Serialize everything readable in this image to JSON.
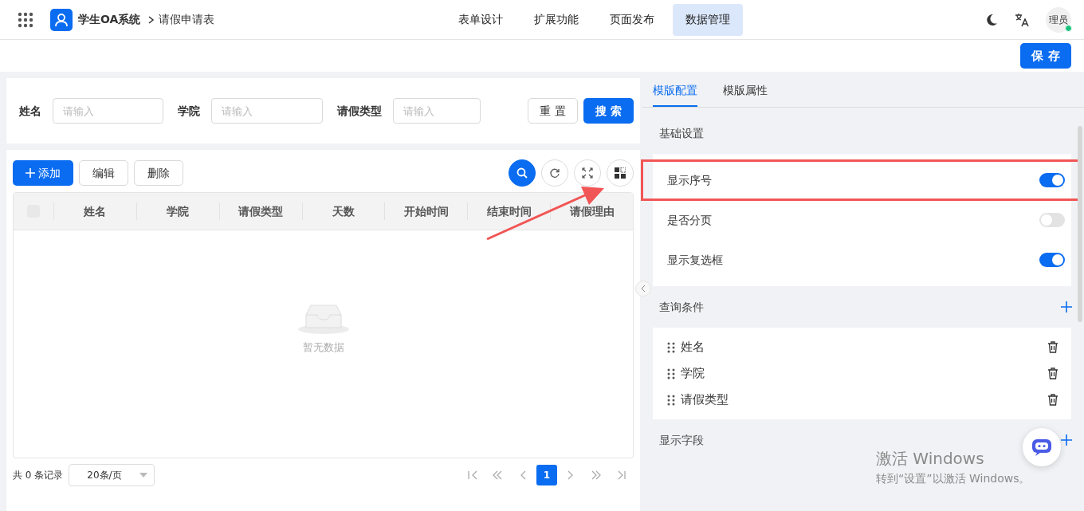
{
  "app": {
    "title": "学生OA系统",
    "breadcrumb": "请假申请表"
  },
  "nav": [
    {
      "label": "表单设计",
      "selected": false
    },
    {
      "label": "扩展功能",
      "selected": false
    },
    {
      "label": "页面发布",
      "selected": false
    },
    {
      "label": "数据管理",
      "selected": true
    }
  ],
  "user": {
    "avatar_text": "理员",
    "online": true
  },
  "save_button": "保 存",
  "search_form": {
    "fields": [
      {
        "label": "姓名",
        "placeholder": "请输入"
      },
      {
        "label": "学院",
        "placeholder": "请输入"
      },
      {
        "label": "请假类型",
        "placeholder": "请输入"
      }
    ],
    "buttons": [
      {
        "label": "重 置",
        "kind": "default"
      },
      {
        "label": "搜 索",
        "kind": "primary"
      }
    ]
  },
  "toolbar": {
    "buttons": [
      {
        "label": "添加",
        "kind": "primary"
      },
      {
        "label": "编辑",
        "kind": "default"
      },
      {
        "label": "删除",
        "kind": "default"
      }
    ]
  },
  "table": {
    "columns": [
      "姓名",
      "学院",
      "请假类型",
      "天数",
      "开始时间",
      "结束时间",
      "请假理由"
    ],
    "empty_text": "暂无数据",
    "select_all_checked": false
  },
  "pagination": {
    "total": "共 0 条记录",
    "page_size": "20条/页",
    "pages": [
      {
        "label": "1",
        "selected": true
      }
    ]
  },
  "panel": {
    "tabs": [
      {
        "label": "模版配置",
        "selected": true
      },
      {
        "label": "模版属性",
        "selected": false
      }
    ],
    "sections": [
      {
        "title": "基础设置",
        "kind": "switches",
        "items": [
          {
            "label": "显示序号",
            "on": true,
            "highlighted": true
          },
          {
            "label": "是否分页",
            "on": false,
            "highlighted": false
          },
          {
            "label": "显示复选框",
            "on": true,
            "highlighted": false
          }
        ]
      },
      {
        "title": "查询条件",
        "kind": "fields",
        "items": [
          {
            "label": "姓名"
          },
          {
            "label": "学院"
          },
          {
            "label": "请假类型"
          }
        ]
      },
      {
        "title": "显示字段",
        "kind": "fields"
      }
    ]
  },
  "os_notice": {
    "title": "激活 Windows",
    "subtitle": "转到“设置”以激活 Windows。"
  }
}
